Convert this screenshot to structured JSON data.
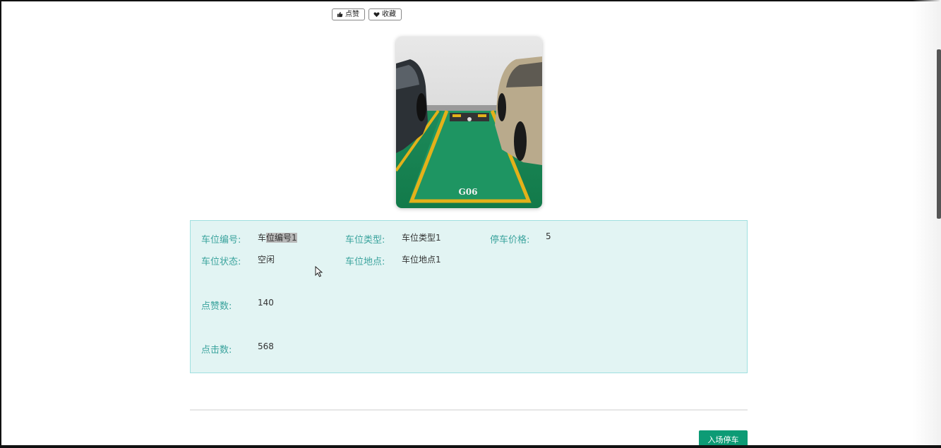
{
  "actions": {
    "like_label": "点赞",
    "favorite_label": "收藏"
  },
  "spot_image": {
    "spot_code_painted": "G06"
  },
  "details": {
    "spot_number_label": "车位编号:",
    "spot_number_prefix": "车",
    "spot_number_selected": "位编号1",
    "spot_type_label": "车位类型:",
    "spot_type_value": "车位类型1",
    "price_label": "停车价格:",
    "price_value": "5",
    "status_label": "车位状态:",
    "status_value": "空闲",
    "location_label": "车位地点:",
    "location_value": "车位地点1",
    "likes_label": "点赞数:",
    "likes_value": "140",
    "clicks_label": "点击数:",
    "clicks_value": "568"
  },
  "footer": {
    "park_button_label": "入场停车"
  },
  "colors": {
    "label": "#3aa39d",
    "panel_bg": "#e2f4f3",
    "panel_border": "#9fe0e0",
    "primary_button": "#0d9b75"
  }
}
